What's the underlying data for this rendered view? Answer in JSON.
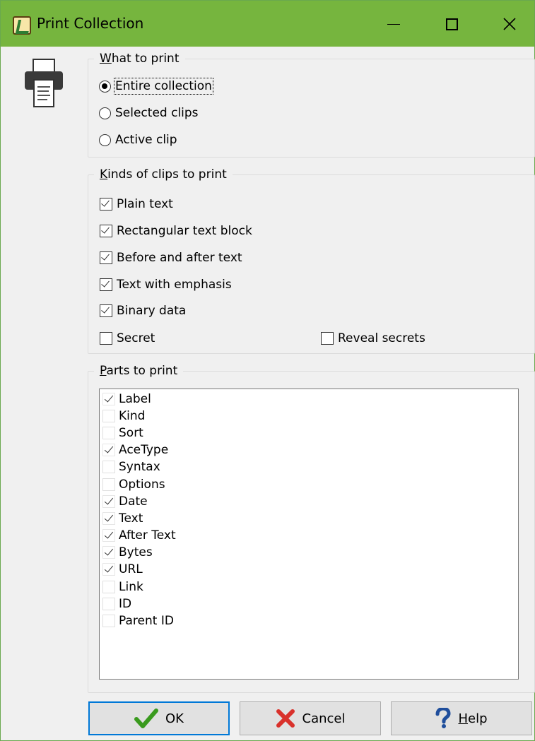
{
  "window": {
    "title": "Print Collection",
    "minimize_icon": "minimize-icon",
    "maximize_icon": "maximize-icon",
    "close_icon": "close-icon"
  },
  "what_to_print": {
    "legend_first": "W",
    "legend_rest": "hat to print",
    "options": [
      {
        "label": "Entire collection",
        "selected": true
      },
      {
        "label": "Selected clips",
        "selected": false
      },
      {
        "label": "Active clip",
        "selected": false
      }
    ]
  },
  "kinds": {
    "legend_first": "K",
    "legend_rest": "inds of clips to print",
    "items": [
      {
        "label": "Plain text",
        "checked": true
      },
      {
        "label": "Rectangular text block",
        "checked": true
      },
      {
        "label": "Before and after text",
        "checked": true
      },
      {
        "label": "Text with emphasis",
        "checked": true
      },
      {
        "label": "Binary data",
        "checked": true
      },
      {
        "label": "Secret",
        "checked": false
      }
    ],
    "reveal_secrets": {
      "label": "Reveal secrets",
      "checked": false
    }
  },
  "parts": {
    "legend_first": "P",
    "legend_rest": "arts to print",
    "items": [
      {
        "label": "Label",
        "checked": true
      },
      {
        "label": "Kind",
        "checked": false
      },
      {
        "label": "Sort",
        "checked": false
      },
      {
        "label": "AceType",
        "checked": true
      },
      {
        "label": "Syntax",
        "checked": false
      },
      {
        "label": "Options",
        "checked": false
      },
      {
        "label": "Date",
        "checked": true
      },
      {
        "label": "Text",
        "checked": true
      },
      {
        "label": "After Text",
        "checked": true
      },
      {
        "label": "Bytes",
        "checked": true
      },
      {
        "label": "URL",
        "checked": true
      },
      {
        "label": "Link",
        "checked": false
      },
      {
        "label": "ID",
        "checked": false
      },
      {
        "label": "Parent ID",
        "checked": false
      }
    ]
  },
  "buttons": {
    "ok": {
      "label": "OK",
      "icon": "green-check-icon",
      "color": "#3a9a1e"
    },
    "cancel": {
      "label": "Cancel",
      "icon": "red-x-icon",
      "color": "#d9312b"
    },
    "help": {
      "label_first": "H",
      "label_rest": "elp",
      "icon": "question-mark-icon",
      "color": "#1f4e9c"
    }
  },
  "colors": {
    "titlebar": "#76b53e",
    "focus_border": "#0078d7"
  }
}
